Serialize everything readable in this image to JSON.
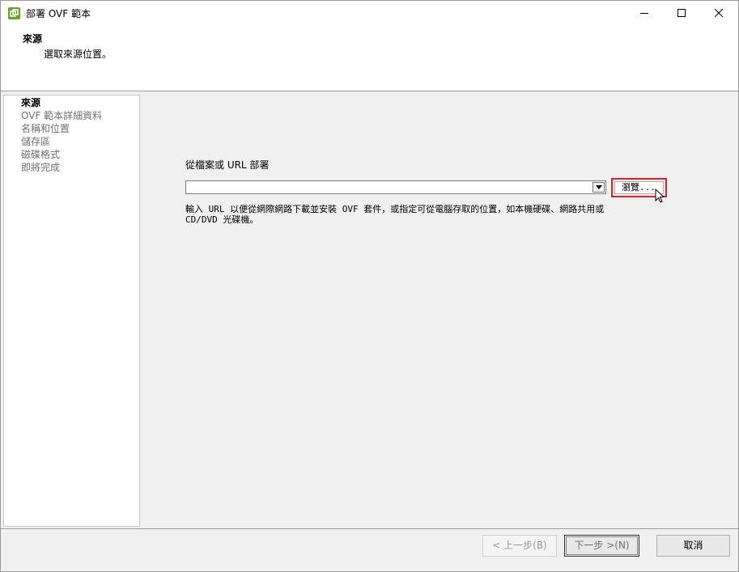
{
  "window": {
    "title": "部署 OVF 範本",
    "controls": {
      "minimize_icon": "minimize-icon",
      "maximize_icon": "maximize-icon",
      "close_icon": "close-icon"
    }
  },
  "header": {
    "title": "來源",
    "subtitle": "選取來源位置。"
  },
  "nav": {
    "items": [
      {
        "label": "來源",
        "active": true
      },
      {
        "label": "OVF 範本詳細資料",
        "active": false
      },
      {
        "label": "名稱和位置",
        "active": false
      },
      {
        "label": "儲存區",
        "active": false
      },
      {
        "label": "磁碟格式",
        "active": false
      },
      {
        "label": "即將完成",
        "active": false
      }
    ]
  },
  "main": {
    "deploy_label": "從檔案或 URL 部署",
    "url_value": "",
    "browse_label": "瀏覽...",
    "help_text": "輸入 URL 以便從網際網路下載並安裝 OVF 套件，或指定可從電腦存取的位置，如本機硬碟、網路共用或\nCD/DVD 光碟機。"
  },
  "footer": {
    "back_label": "< 上一步(B)",
    "next_label": "下一步 >(N)",
    "cancel_label": "取消"
  },
  "colors": {
    "highlight": "#e0202a",
    "panel_bg": "#f0f0f0",
    "disabled_text": "#9a9a9a"
  }
}
